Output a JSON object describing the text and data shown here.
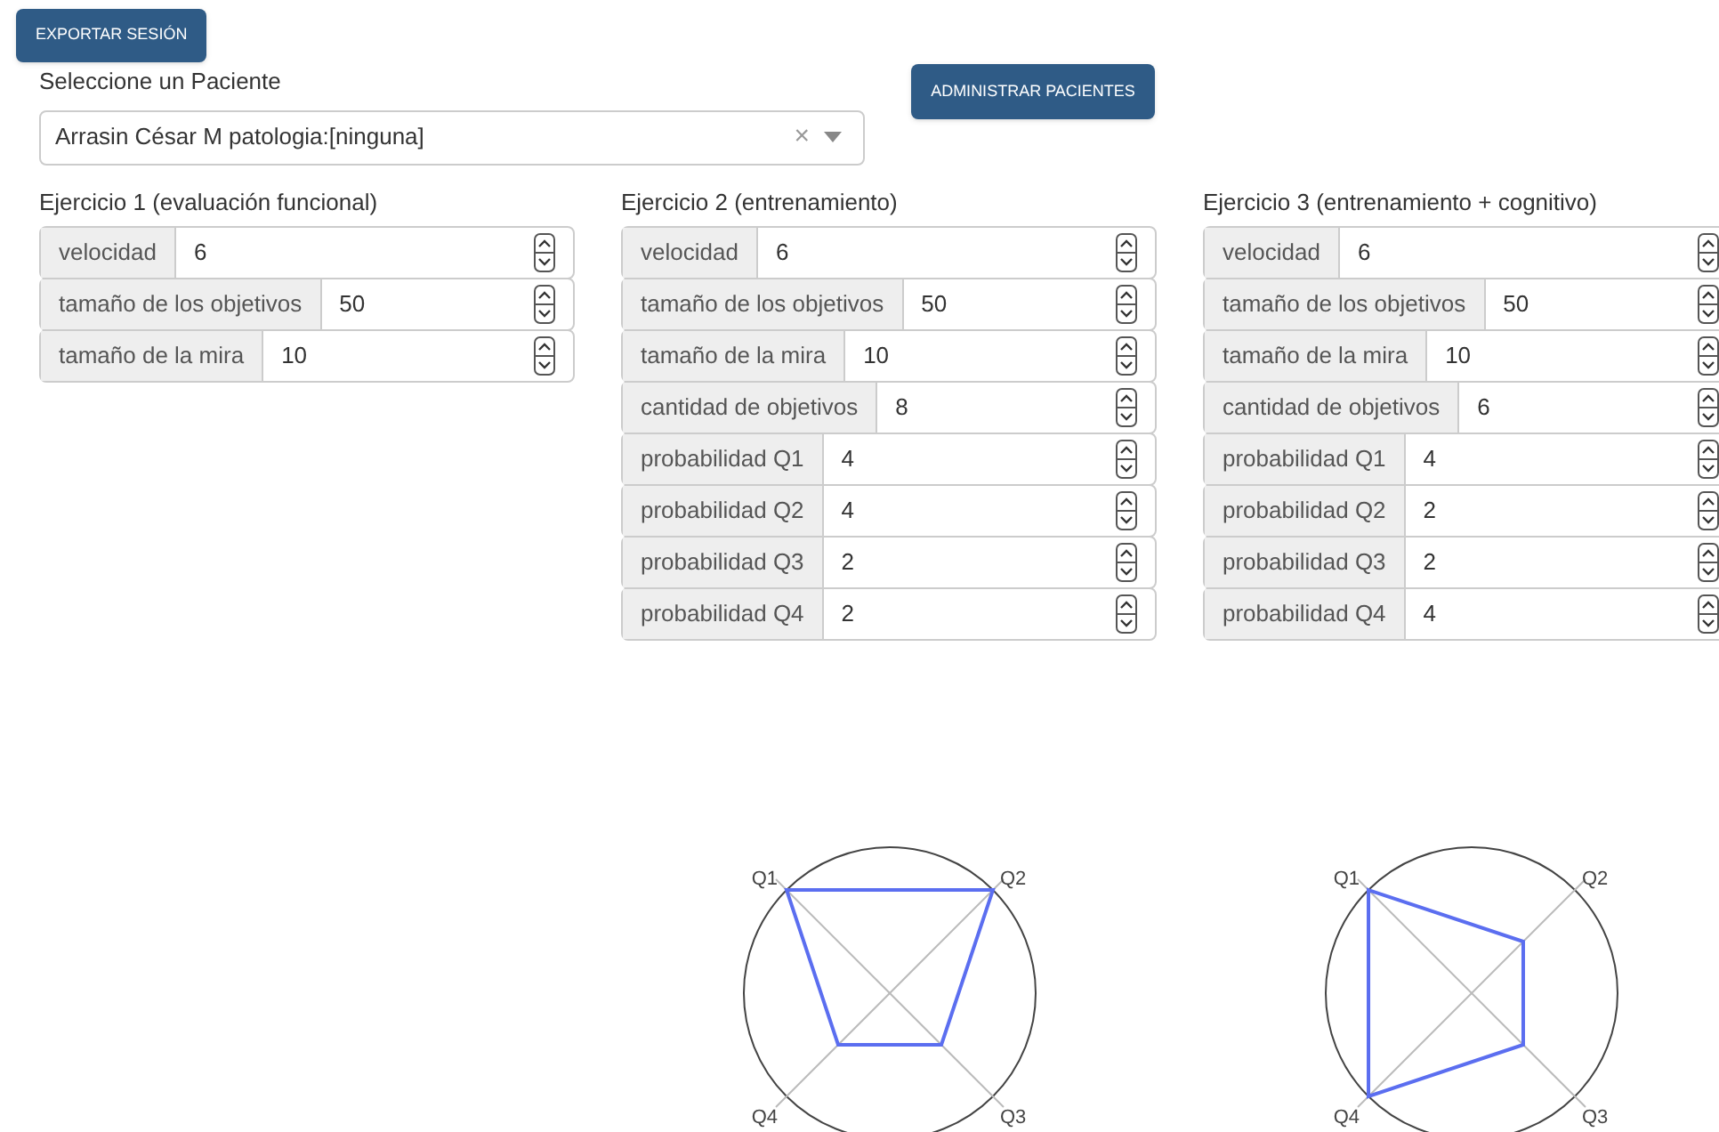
{
  "export_button": "EXPORTAR SESIÓN",
  "patient": {
    "label": "Seleccione un Paciente",
    "value": "Arrasin César M patologia:[ninguna]",
    "clear": "×"
  },
  "manage_button": "ADMINISTRAR PACIENTES",
  "exercises": [
    {
      "title": "Ejercicio 1 (evaluación funcional)",
      "fields": [
        {
          "label": "velocidad",
          "value": "6"
        },
        {
          "label": "tamaño de los objetivos",
          "value": "50"
        },
        {
          "label": "tamaño de la mira",
          "value": "10"
        }
      ]
    },
    {
      "title": "Ejercicio 2 (entrenamiento)",
      "fields": [
        {
          "label": "velocidad",
          "value": "6"
        },
        {
          "label": "tamaño de los objetivos",
          "value": "50"
        },
        {
          "label": "tamaño de la mira",
          "value": "10"
        },
        {
          "label": "cantidad de objetivos",
          "value": "8"
        },
        {
          "label": "probabilidad Q1",
          "value": "4"
        },
        {
          "label": "probabilidad Q2",
          "value": "4"
        },
        {
          "label": "probabilidad Q3",
          "value": "2"
        },
        {
          "label": "probabilidad Q4",
          "value": "2"
        }
      ],
      "chart": {
        "axis_labels": [
          "Q1",
          "Q2",
          "Q4",
          "Q3"
        ]
      }
    },
    {
      "title": "Ejercicio 3 (entrenamiento + cognitivo)",
      "fields": [
        {
          "label": "velocidad",
          "value": "6"
        },
        {
          "label": "tamaño de los objetivos",
          "value": "50"
        },
        {
          "label": "tamaño de la mira",
          "value": "10"
        },
        {
          "label": "cantidad de objetivos",
          "value": "6"
        },
        {
          "label": "probabilidad Q1",
          "value": "4"
        },
        {
          "label": "probabilidad Q2",
          "value": "2"
        },
        {
          "label": "probabilidad Q3",
          "value": "2"
        },
        {
          "label": "probabilidad Q4",
          "value": "4"
        }
      ],
      "chart": {
        "axis_labels": [
          "Q1",
          "Q2",
          "Q4",
          "Q3"
        ]
      }
    }
  ]
}
